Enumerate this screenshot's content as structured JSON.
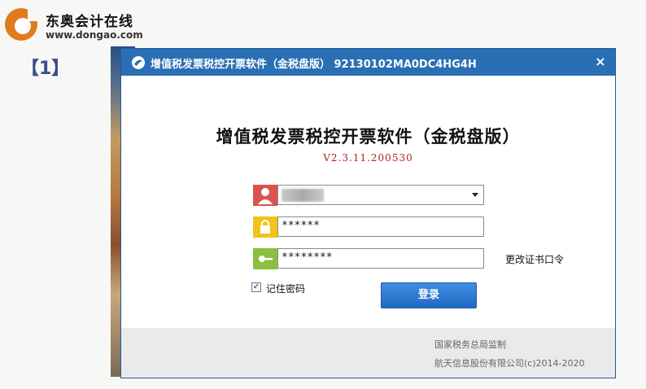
{
  "brand": {
    "name": "东奥会计在线",
    "url": "www.dongao.com",
    "logo_icon": "dongao-logo-icon",
    "accent": "#e07b1f"
  },
  "slide_index": "【1】",
  "window": {
    "title": "增值税发票税控开票软件（金税盘版） 92130102MA0DC4HG4H",
    "close_label": "×",
    "title_icon": "app-logo-icon",
    "titlebar_color": "#2a6fb3"
  },
  "login": {
    "app_title": "增值税发票税控开票软件（金税盘版）",
    "version": "V2.3.11.200530",
    "username_icon": "user-icon",
    "username_value": "",
    "password_icon": "lock-icon",
    "password_value": "******",
    "cert_icon": "key-icon",
    "cert_password_value": "********",
    "change_cert_label": "更改证书口令",
    "remember_label": "记住密码",
    "remember_checked": true,
    "login_button": "登录"
  },
  "footer": {
    "line1": "国家税务总局监制",
    "line2": "航天信息股份有限公司(c)2014-2020"
  }
}
